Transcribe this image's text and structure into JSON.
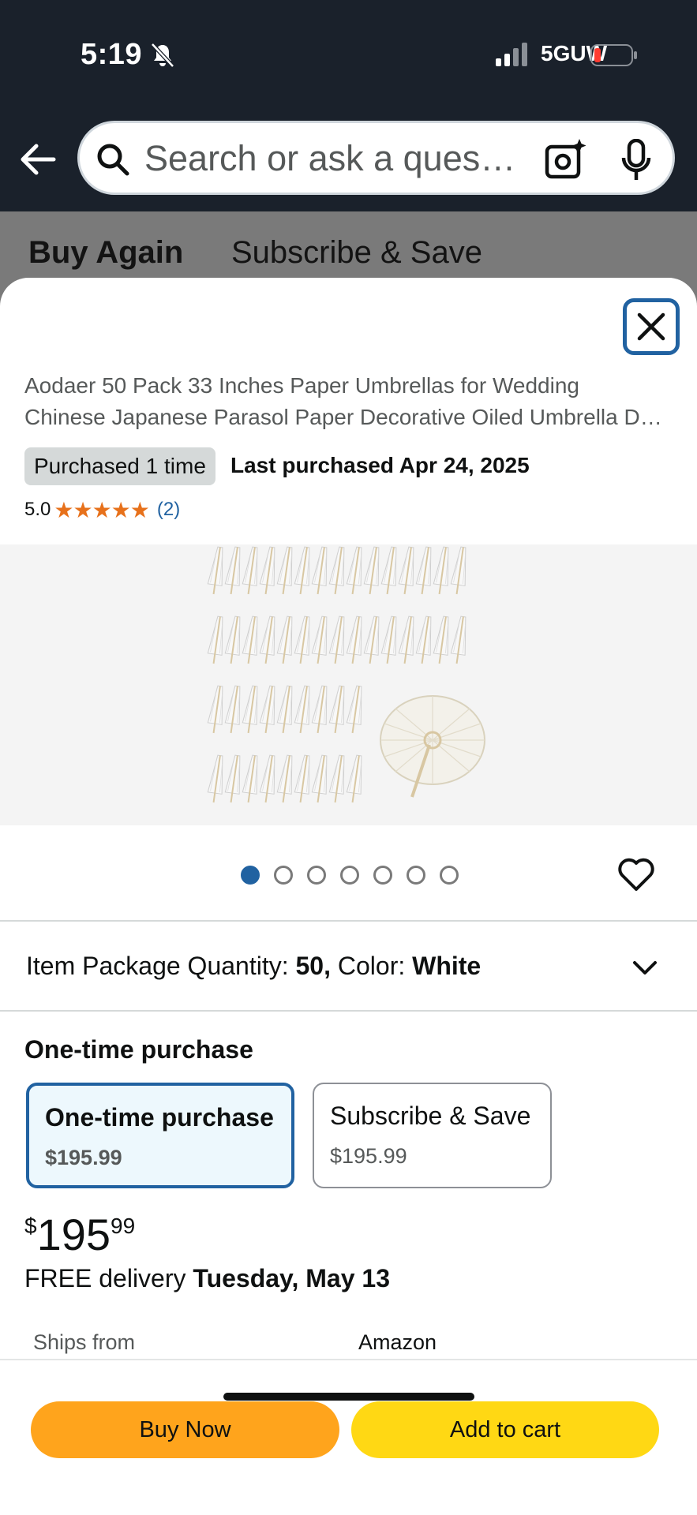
{
  "status_bar": {
    "time": "5:19",
    "network": "5GUW",
    "icons": [
      "bell-slash-icon",
      "signal-icon",
      "battery-icon"
    ]
  },
  "header": {
    "back_icon": "arrow-left-icon",
    "search_placeholder": "Search or ask a ques…",
    "icons": [
      "search-icon",
      "camera-icon",
      "microphone-icon"
    ]
  },
  "tabs": [
    {
      "label": "Buy Again"
    },
    {
      "label": "Subscribe & Save"
    }
  ],
  "product": {
    "title_line1": "Aodaer 50 Pack 33 Inches Paper Umbrellas for Wedding",
    "title_line2": "Chinese Japanese Parasol Paper Decorative Oiled Umbrella D…",
    "purchased_badge": "Purchased 1 time",
    "last_purchased": "Last purchased Apr 24, 2025",
    "rating": "5.0",
    "stars": "★★★★★",
    "rating_count": "(2)",
    "image_count": 7,
    "active_image_index": 0
  },
  "variation": {
    "label_qty": "Item Package Quantity: ",
    "value_qty": "50,",
    "label_color": " Color: ",
    "value_color": "White"
  },
  "purchase_options": {
    "heading": "One-time purchase",
    "options": [
      {
        "label": "One-time purchase",
        "price": "$195.99",
        "selected": true
      },
      {
        "label": "Subscribe & Save",
        "price": "$195.99",
        "selected": false
      }
    ]
  },
  "price": {
    "symbol": "$",
    "whole": "195",
    "fraction": "99"
  },
  "delivery": {
    "prefix": "FREE delivery ",
    "date": "Tuesday, May 13"
  },
  "ships_from": {
    "label": "Ships from",
    "value": "Amazon"
  },
  "actions": {
    "buy_now": "Buy Now",
    "add_to_cart": "Add to cart"
  },
  "colors": {
    "header_bg": "#1a212b",
    "link_blue": "#2162a1",
    "star_orange": "#e7711b",
    "buy_now": "#ffa41c",
    "add_to_cart": "#ffd814",
    "selected_option_bg": "#edf8fd"
  }
}
